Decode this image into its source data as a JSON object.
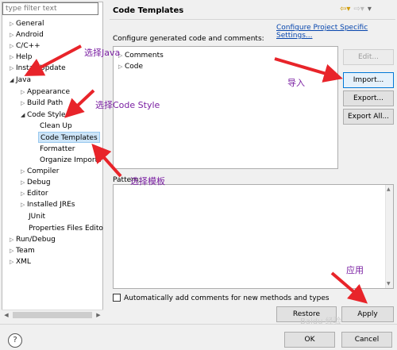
{
  "left": {
    "filter_placeholder": "type filter text",
    "items": [
      {
        "label": "General"
      },
      {
        "label": "Android"
      },
      {
        "label": "C/C++"
      },
      {
        "label": "Help"
      },
      {
        "label": "Install/Update"
      },
      {
        "label": "Java"
      },
      {
        "label": "Appearance"
      },
      {
        "label": "Build Path"
      },
      {
        "label": "Code Style"
      },
      {
        "label": "Clean Up"
      },
      {
        "label": "Code Templates"
      },
      {
        "label": "Formatter"
      },
      {
        "label": "Organize Imports"
      },
      {
        "label": "Compiler"
      },
      {
        "label": "Debug"
      },
      {
        "label": "Editor"
      },
      {
        "label": "Installed JREs"
      },
      {
        "label": "JUnit"
      },
      {
        "label": "Properties Files Edito"
      },
      {
        "label": "Run/Debug"
      },
      {
        "label": "Team"
      },
      {
        "label": "XML"
      }
    ]
  },
  "page": {
    "title": "Code Templates",
    "configure_link": "Configure Project Specific Settings...",
    "description": "Configure generated code and comments:",
    "templates": [
      {
        "label": "Comments"
      },
      {
        "label": "Code"
      }
    ],
    "pattern_label": "Pattern:",
    "buttons": {
      "edit": "Edit...",
      "import": "Import...",
      "export": "Export...",
      "export_all": "Export All...",
      "restore": "Restore Defaults",
      "apply": "Apply"
    },
    "auto_comment": "Automatically add comments for new methods and types"
  },
  "footer": {
    "ok": "OK",
    "cancel": "Cancel",
    "help_icon": "?"
  },
  "annotations": {
    "select_java": "选择Java",
    "select_code_style": "选择Code Style",
    "select_template": "选择模板",
    "import": "导入",
    "apply": "应用"
  },
  "watermark": "Baidu 经验",
  "colors": {
    "arrow": "#e8242a",
    "annotation": "#7a1fa2",
    "link": "#0645ad",
    "selection": "#cce4f7"
  }
}
